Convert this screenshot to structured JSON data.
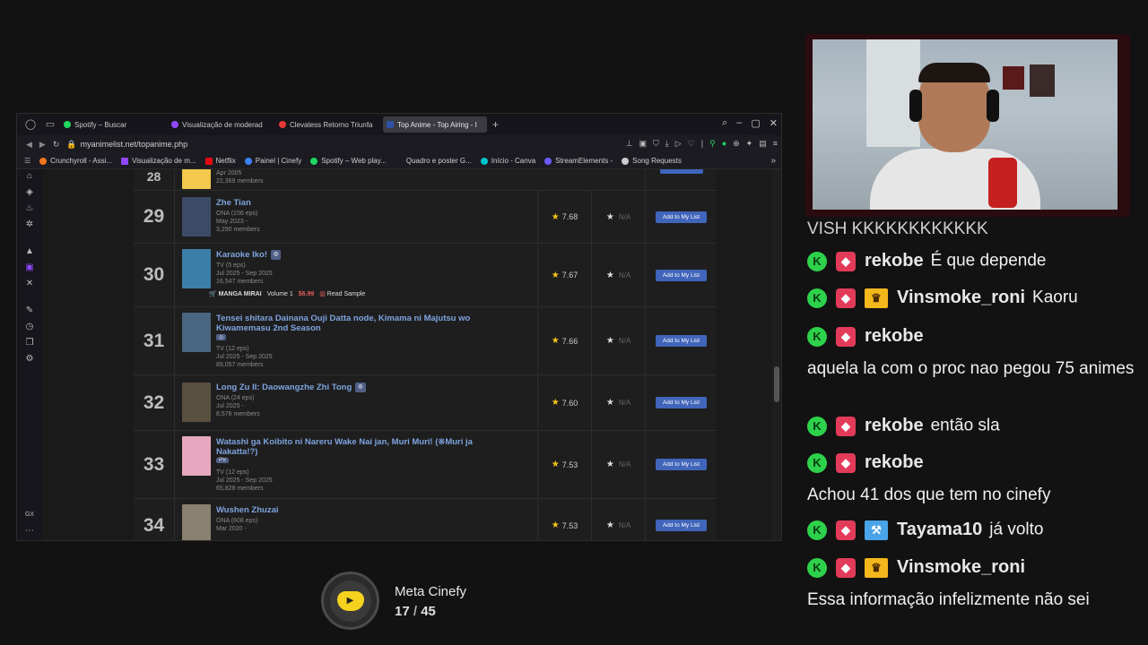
{
  "browser": {
    "tabs": [
      {
        "label": "Spotify – Buscar",
        "color": "#1ed760"
      },
      {
        "label": "Visualização de moderad",
        "color": "#9147ff"
      },
      {
        "label": "Clevatess Retorno Triunfa",
        "color": "#e53935"
      },
      {
        "label": "Top Anime - Top Airing - I",
        "color": "#2e51a2",
        "active": true
      }
    ],
    "url": "myanimelist.net/topanime.php",
    "bookmarks": [
      {
        "label": "Crunchyroll - Assi...",
        "color": "#f47521"
      },
      {
        "label": "Visualização de m...",
        "color": "#9147ff"
      },
      {
        "label": "Netflix",
        "color": "#e50914"
      },
      {
        "label": "Painel | Cinefy",
        "color": "#3b82f6"
      },
      {
        "label": "Spotify – Web play...",
        "color": "#1ed760"
      },
      {
        "label": "Quadro e poster G...",
        "color": "#888888"
      },
      {
        "label": "Início - Canva",
        "color": "#00c4cc"
      },
      {
        "label": "StreamElements -",
        "color": "#6b5bff"
      },
      {
        "label": "Song Requests",
        "color": "#cccccc"
      }
    ]
  },
  "anime": {
    "partial_row": {
      "meta": "Apr 2005",
      "members": "22,369 members"
    },
    "add_label": "Add to My List",
    "na": "N/A",
    "rows": [
      {
        "rank": "29",
        "title": "Zhe Tian",
        "type": "ONA (156 eps)",
        "date": "May 2023 -",
        "members": "3,290 members",
        "score": "7.68",
        "thumb": "#3d4a66"
      },
      {
        "rank": "30",
        "title": "Karaoke Iko!",
        "type": "TV (5 eps)",
        "date": "Jul 2025 - Sep 2025",
        "members": "16,547 members",
        "score": "7.67",
        "thumb": "#3b7fa8",
        "manga": {
          "brand": "MANGA MIRAI",
          "volume": "Volume 1",
          "price": "$6.99",
          "read": "Read Sample"
        }
      },
      {
        "rank": "31",
        "title": "Tensei shitara Dainana Ouji Datta node, Kimama ni Majutsu wo Kiwamemasu 2nd Season",
        "type": "TV (12 eps)",
        "date": "Jul 2025 - Sep 2025",
        "members": "89,057 members",
        "score": "7.66",
        "thumb": "#4a6680"
      },
      {
        "rank": "32",
        "title": "Long Zu II: Daowangzhe Zhi Tong",
        "type": "ONA (24 eps)",
        "date": "Jul 2025 -",
        "members": "8,578 members",
        "score": "7.60",
        "thumb": "#5a5040"
      },
      {
        "rank": "33",
        "title": "Watashi ga Koibito ni Nareru Wake Nai jan, Muri Muri! (※Muri ja Nakatta!?)",
        "type": "TV (12 eps)",
        "date": "Jul 2025 - Sep 2025",
        "members": "65,828 members",
        "score": "7.53",
        "thumb": "#e8a7c0",
        "badge": "PV"
      },
      {
        "rank": "34",
        "title": "Wushen Zhuzai",
        "type": "ONA (608 eps)",
        "date": "Mar 2020 -",
        "members": "",
        "score": "7.53",
        "thumb": "#8a8070"
      }
    ]
  },
  "goal": {
    "title": "Meta Cinefy",
    "current": "17",
    "separator": "/",
    "target": "45"
  },
  "chat": {
    "top_cut": "VISH KKKKKKKKKKKK",
    "messages": [
      {
        "user": "rekobe",
        "text": "É que depende",
        "badge": "sq"
      },
      {
        "user": "Vinsmoke_roni",
        "text": "Kaoru",
        "badge": "crown"
      },
      {
        "user": "rekobe",
        "text": "",
        "badge": "sq",
        "continued": "aquela la com o proc nao pegou 75 animes"
      },
      {
        "user": "rekobe",
        "text": "então sla",
        "badge": "sq"
      },
      {
        "user": "rekobe",
        "text": "",
        "badge": "sq",
        "continued": "Achou 41 dos que tem no cinefy"
      },
      {
        "user": "Tayama10",
        "text": "já volto",
        "badge": "hammer"
      },
      {
        "user": "Vinsmoke_roni",
        "text": "",
        "badge": "crown",
        "continued": "Essa informação infelizmente não sei"
      }
    ]
  }
}
